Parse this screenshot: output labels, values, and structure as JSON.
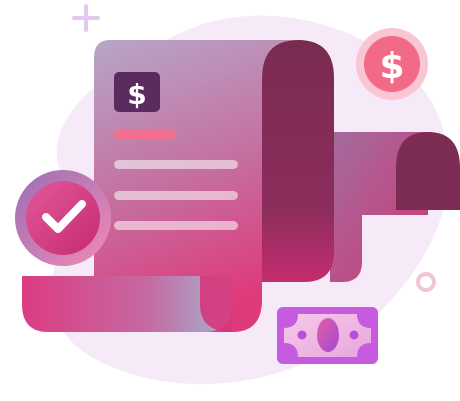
{
  "illustration": {
    "receipt_badge_symbol": "$",
    "coin_symbol": "$",
    "check_badge_icon": "checkmark-icon",
    "colors": {
      "blob": "#f5e7f7",
      "receipt_light": "#b8a1c6",
      "receipt_pink": "#d83b7c",
      "roll_dark": "#7e2c52",
      "badge_dark": "#5b2a5e",
      "accent_pink": "#f0708c",
      "coin": "#f36a86",
      "banknote_border": "#c65be0"
    }
  }
}
